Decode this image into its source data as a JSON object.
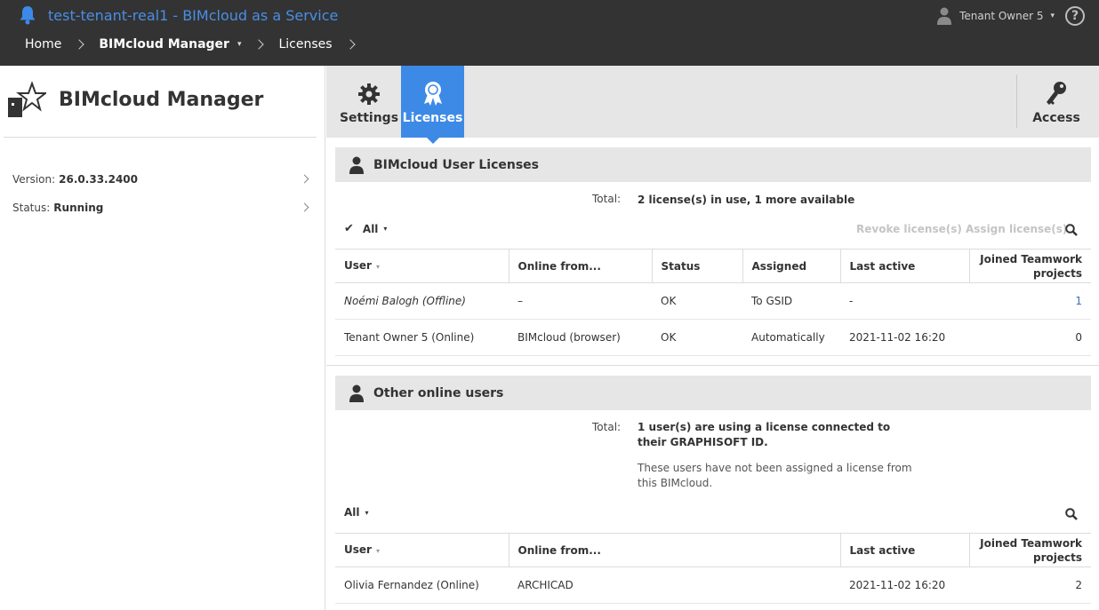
{
  "topbar": {
    "app_title": "test-tenant-real1 - BIMcloud as a Service",
    "user_name": "Tenant Owner 5",
    "help_glyph": "?",
    "caret": "▾"
  },
  "breadcrumb": {
    "home": "Home",
    "manager": "BIMcloud Manager",
    "licenses": "Licenses",
    "caret": "▾"
  },
  "left": {
    "title": "BIMcloud Manager",
    "version_label": "Version:",
    "version_value": "26.0.33.2400",
    "status_label": "Status:",
    "status_value": "Running"
  },
  "tabs": {
    "settings": "Settings",
    "licenses": "Licenses",
    "access": "Access"
  },
  "user_licenses": {
    "title": "BIMcloud User Licenses",
    "total_label": "Total:",
    "total_value": "2 license(s) in use, 1 more available",
    "filter_check": "✔",
    "filter_label": "All",
    "filter_caret": "▾",
    "revoke_label": "Revoke license(s)",
    "assign_label": "Assign license(s)",
    "columns": {
      "user": "User",
      "sort": "▾",
      "online_from": "Online from...",
      "status": "Status",
      "assigned": "Assigned",
      "last_active": "Last active",
      "joined": "Joined Teamwork projects"
    },
    "rows": [
      {
        "user": "Noémi Balogh (Offline)",
        "online_from": "–",
        "status": "OK",
        "assigned": "To GSID",
        "last_active": "-",
        "joined": "1"
      },
      {
        "user": "Tenant Owner 5 (Online)",
        "online_from": "BIMcloud (browser)",
        "status": "OK",
        "assigned": "Automatically",
        "last_active": "2021-11-02 16:20",
        "joined": "0"
      }
    ]
  },
  "other_users": {
    "title": "Other online users",
    "total_label": "Total:",
    "total_value": "1 user(s) are using a license connected to their GRAPHISOFT ID.",
    "note": "These users have not been assigned a license from this BIMcloud.",
    "filter_label": "All",
    "filter_caret": "▾",
    "columns": {
      "user": "User",
      "sort": "▾",
      "online_from": "Online from...",
      "last_active": "Last active",
      "joined": "Joined Teamwork projects"
    },
    "rows": [
      {
        "user": "Olivia Fernandez (Online)",
        "online_from": "ARCHICAD",
        "last_active": "2021-11-02 16:20",
        "joined": "2"
      }
    ]
  },
  "colors": {
    "topbar": "#333333",
    "accent": "#3d8ae6",
    "title_blue": "#4a8ee6",
    "panel_gray": "#e6e6e6"
  }
}
